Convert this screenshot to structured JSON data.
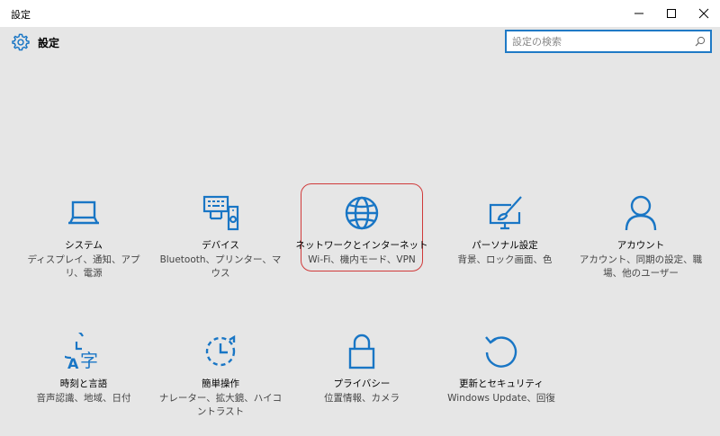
{
  "window": {
    "title": "設定"
  },
  "header": {
    "title": "設定",
    "search_placeholder": "設定の検索"
  },
  "colors": {
    "accent": "#1f7ac6",
    "icon": "#1976c5",
    "highlight_border": "#d03a3a"
  },
  "tiles": [
    {
      "label": "システム",
      "desc": "ディスプレイ、通知、アプリ、電源",
      "icon": "laptop-icon"
    },
    {
      "label": "デバイス",
      "desc": "Bluetooth、プリンター、マウス",
      "icon": "devices-icon"
    },
    {
      "label": "ネットワークとインターネット",
      "desc": "Wi-Fi、機内モード、VPN",
      "icon": "globe-icon"
    },
    {
      "label": "パーソナル設定",
      "desc": "背景、ロック画面、色",
      "icon": "personalization-icon"
    },
    {
      "label": "アカウント",
      "desc": "アカウント、同期の設定、職場、他のユーザー",
      "icon": "account-icon"
    },
    {
      "label": "時刻と言語",
      "desc": "音声認識、地域、日付",
      "icon": "time-language-icon"
    },
    {
      "label": "簡単操作",
      "desc": "ナレーター、拡大鏡、ハイコントラスト",
      "icon": "ease-of-access-icon"
    },
    {
      "label": "プライバシー",
      "desc": "位置情報、カメラ",
      "icon": "lock-icon"
    },
    {
      "label": "更新とセキュリティ",
      "desc": "Windows Update、回復",
      "icon": "update-icon"
    }
  ]
}
